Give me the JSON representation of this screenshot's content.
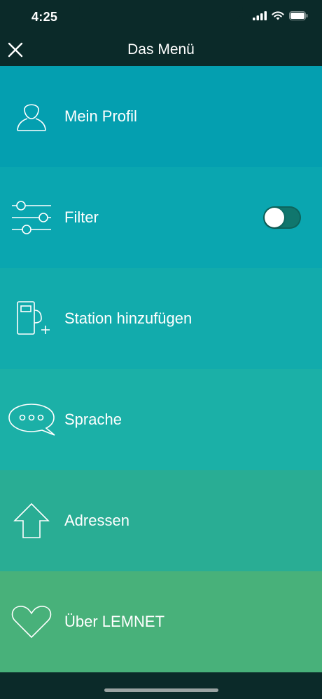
{
  "status_bar": {
    "time": "4:25"
  },
  "nav": {
    "title": "Das Menü",
    "close_icon": "close-icon"
  },
  "menu": {
    "items": [
      {
        "label": "Mein Profil",
        "icon": "user-icon",
        "color": "#049fb0"
      },
      {
        "label": "Filter",
        "icon": "sliders-icon",
        "color": "#0aa6b0",
        "toggle": {
          "on": false
        }
      },
      {
        "label": "Station hinzufügen",
        "icon": "charging-station-add-icon",
        "color": "#12abac"
      },
      {
        "label": "Sprache",
        "icon": "speech-bubble-icon",
        "color": "#1bb0a7"
      },
      {
        "label": "Adressen",
        "icon": "house-icon",
        "color": "#29ad94"
      },
      {
        "label": "Über LEMNET",
        "icon": "heart-icon",
        "color": "#48b17a"
      }
    ]
  },
  "colors": {
    "background": "#0b2a29",
    "toggle_track": "#10766d"
  }
}
